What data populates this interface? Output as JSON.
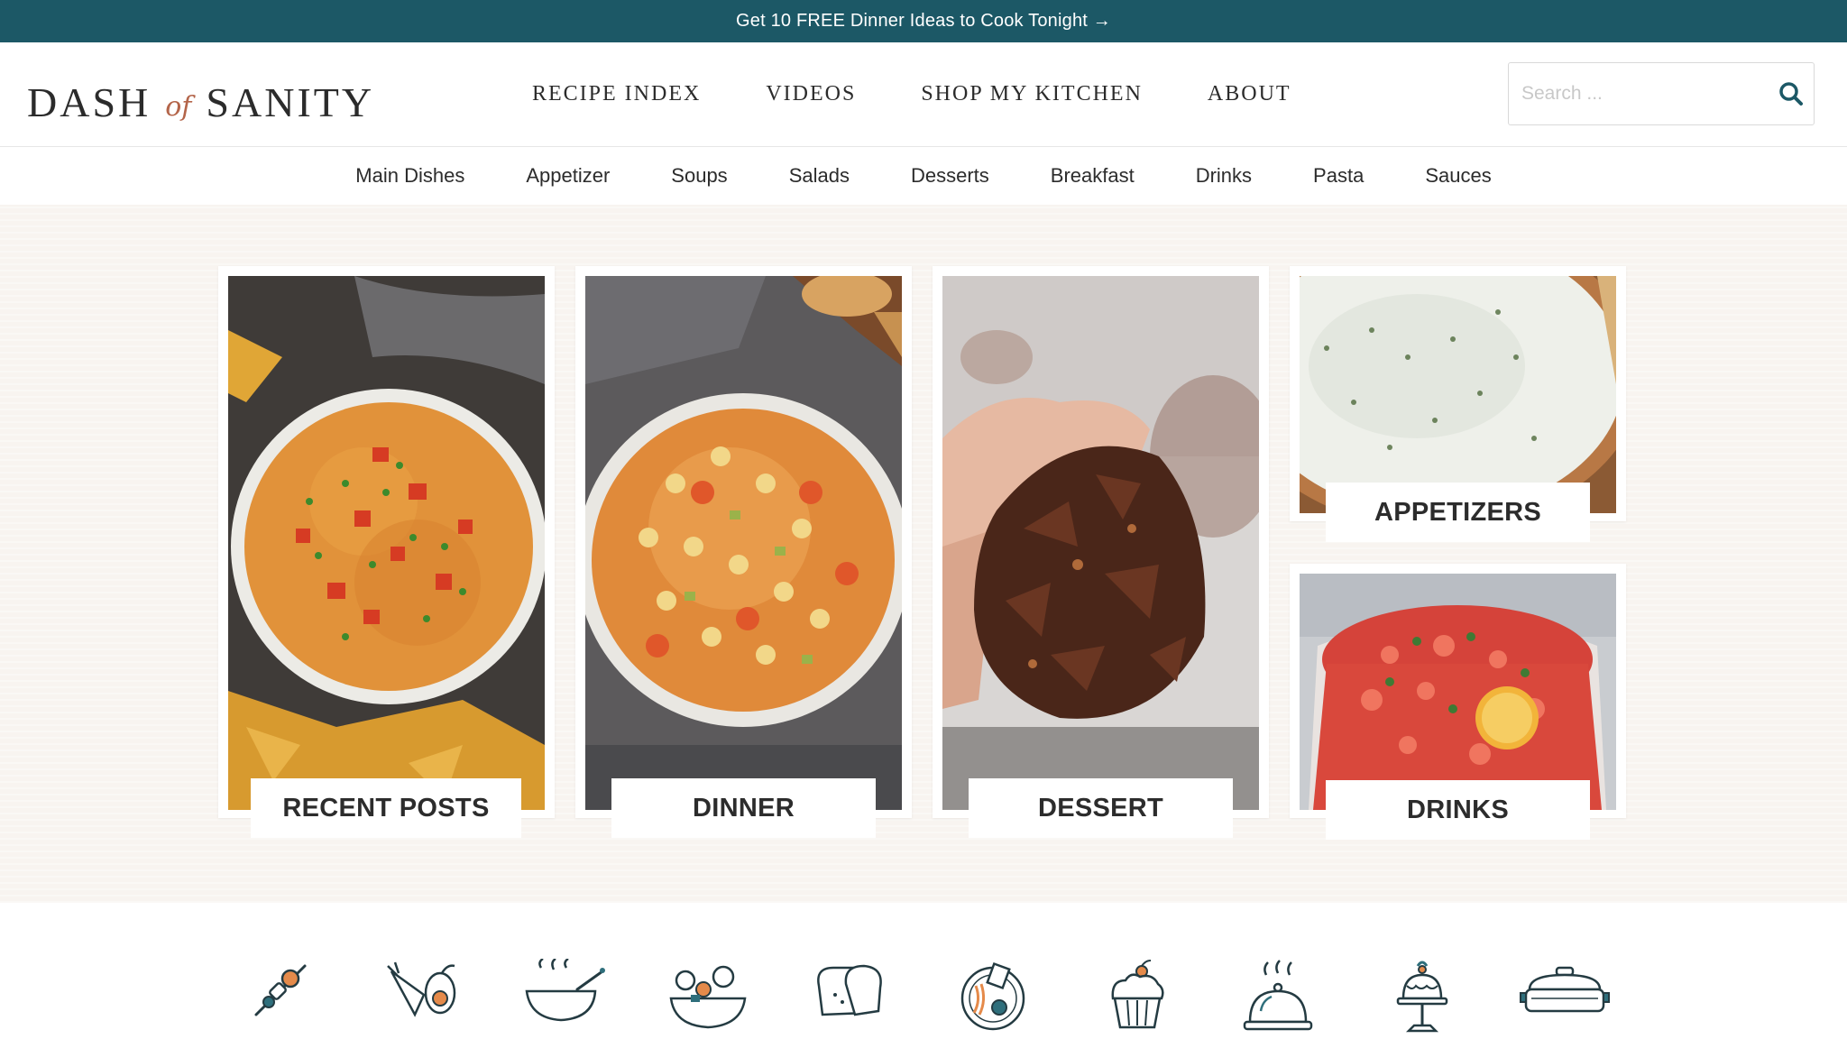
{
  "announcement": {
    "text": "Get 10 FREE Dinner Ideas to Cook Tonight →"
  },
  "brand": {
    "name_part1": "DASH",
    "name_of": "of",
    "name_part2": "SANITY"
  },
  "main_nav": [
    {
      "label": "RECIPE INDEX"
    },
    {
      "label": "VIDEOS"
    },
    {
      "label": "SHOP MY KITCHEN"
    },
    {
      "label": "ABOUT"
    }
  ],
  "search": {
    "placeholder": "Search ...",
    "icon": "search-icon"
  },
  "sub_nav": [
    {
      "label": "Main Dishes"
    },
    {
      "label": "Appetizer"
    },
    {
      "label": "Soups"
    },
    {
      "label": "Salads"
    },
    {
      "label": "Desserts"
    },
    {
      "label": "Breakfast"
    },
    {
      "label": "Drinks"
    },
    {
      "label": "Pasta"
    },
    {
      "label": "Sauces"
    }
  ],
  "cards": {
    "recent": {
      "label": "RECENT POSTS",
      "image": "queso-dip-bowl-photo"
    },
    "dinner": {
      "label": "DINNER",
      "image": "pasta-soup-bowl-photo"
    },
    "dessert": {
      "label": "DESSERT",
      "image": "chocolate-cluster-photo"
    },
    "appetizers": {
      "label": "APPETIZERS",
      "image": "spinach-dip-photo"
    },
    "drinks": {
      "label": "DRINKS",
      "image": "berry-drink-photo"
    }
  },
  "category_icons": [
    "skewer-icon",
    "vegetables-icon",
    "soup-bowl-icon",
    "salad-bowl-icon",
    "bread-icon",
    "breakfast-plate-icon",
    "cupcake-icon",
    "cloche-icon",
    "cake-stand-icon",
    "casserole-dish-icon"
  ],
  "colors": {
    "brand_teal": "#1c5866",
    "accent_rust": "#b4654a",
    "hero_bg": "#f8f4f0"
  }
}
